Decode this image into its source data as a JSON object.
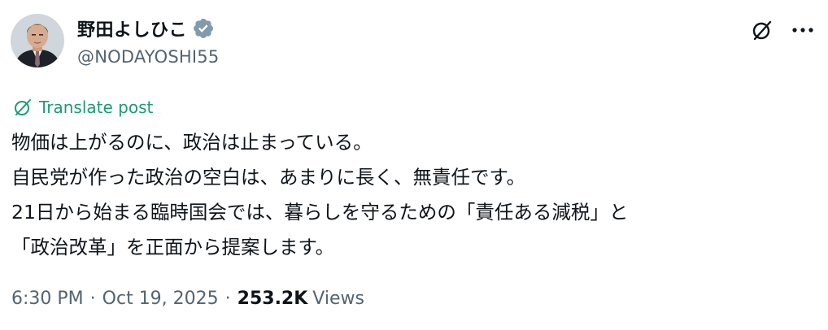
{
  "author": {
    "display_name": "野田よしひこ",
    "handle": "@NODAYOSHI55",
    "verified_badge": "verified-badge-icon",
    "verified_color": "#829aab"
  },
  "actions": {
    "grok_icon": "grok-icon",
    "more_icon": "more-icon"
  },
  "translate": {
    "label": "Translate post",
    "icon": "translate-icon",
    "color": "#1d9b73"
  },
  "post": {
    "lines": [
      "物価は上がるのに、政治は止まっている。",
      "自民党が作った政治の空白は、あまりに長く、無責任です。",
      "21日から始まる臨時国会では、暮らしを守るための「責任ある減税」と",
      "「政治改革」を正面から提案します。"
    ]
  },
  "meta": {
    "time": "6:30 PM",
    "date": "Oct 19, 2025",
    "separator": "·",
    "views_count": "253.2K",
    "views_label": "Views"
  }
}
